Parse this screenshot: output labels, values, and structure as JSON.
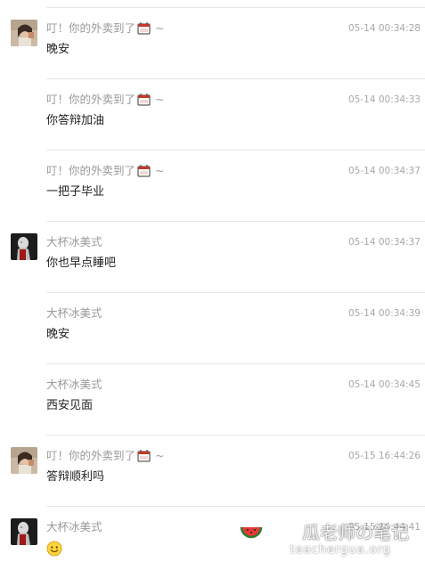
{
  "messages": [
    {
      "sender": "叮！你的外卖到了",
      "sender_suffix": "~",
      "has_box_emoji": true,
      "avatar": "photo-girl",
      "time": "05-14 00:34:28",
      "text": "晚安",
      "show_avatar": true
    },
    {
      "sender": "叮！你的外卖到了",
      "sender_suffix": "~",
      "has_box_emoji": true,
      "avatar": "photo-girl",
      "time": "05-14 00:34:33",
      "text": "你答辩加油",
      "show_avatar": false
    },
    {
      "sender": "叮！你的外卖到了",
      "sender_suffix": "~",
      "has_box_emoji": true,
      "avatar": "photo-girl",
      "time": "05-14 00:34:37",
      "text": "一把子毕业",
      "show_avatar": false
    },
    {
      "sender": "大杯冰美式",
      "sender_suffix": "",
      "has_box_emoji": false,
      "avatar": "photo-statue",
      "time": "05-14 00:34:37",
      "text": "你也早点睡吧",
      "show_avatar": true
    },
    {
      "sender": "大杯冰美式",
      "sender_suffix": "",
      "has_box_emoji": false,
      "avatar": "photo-statue",
      "time": "05-14 00:34:39",
      "text": "晚安",
      "show_avatar": false
    },
    {
      "sender": "大杯冰美式",
      "sender_suffix": "",
      "has_box_emoji": false,
      "avatar": "photo-statue",
      "time": "05-14 00:34:45",
      "text": "西安见面",
      "show_avatar": false
    },
    {
      "sender": "叮！你的外卖到了",
      "sender_suffix": "~",
      "has_box_emoji": true,
      "avatar": "photo-girl",
      "time": "05-15 16:44:26",
      "text": "答辩顺利吗",
      "show_avatar": true
    },
    {
      "sender": "大杯冰美式",
      "sender_suffix": "",
      "has_box_emoji": false,
      "avatar": "photo-statue",
      "time": "05-15 16:44:41",
      "text": "",
      "emoji": "smile-emoji",
      "show_avatar": true
    }
  ],
  "watermark": {
    "title": "瓜老师の笔记",
    "url": "teachergua.org",
    "icon": "watermelon-icon"
  },
  "colors": {
    "name": "#9a9a9a",
    "time": "#a8a8a8",
    "text": "#222222",
    "divider": "#e6e6e6"
  }
}
